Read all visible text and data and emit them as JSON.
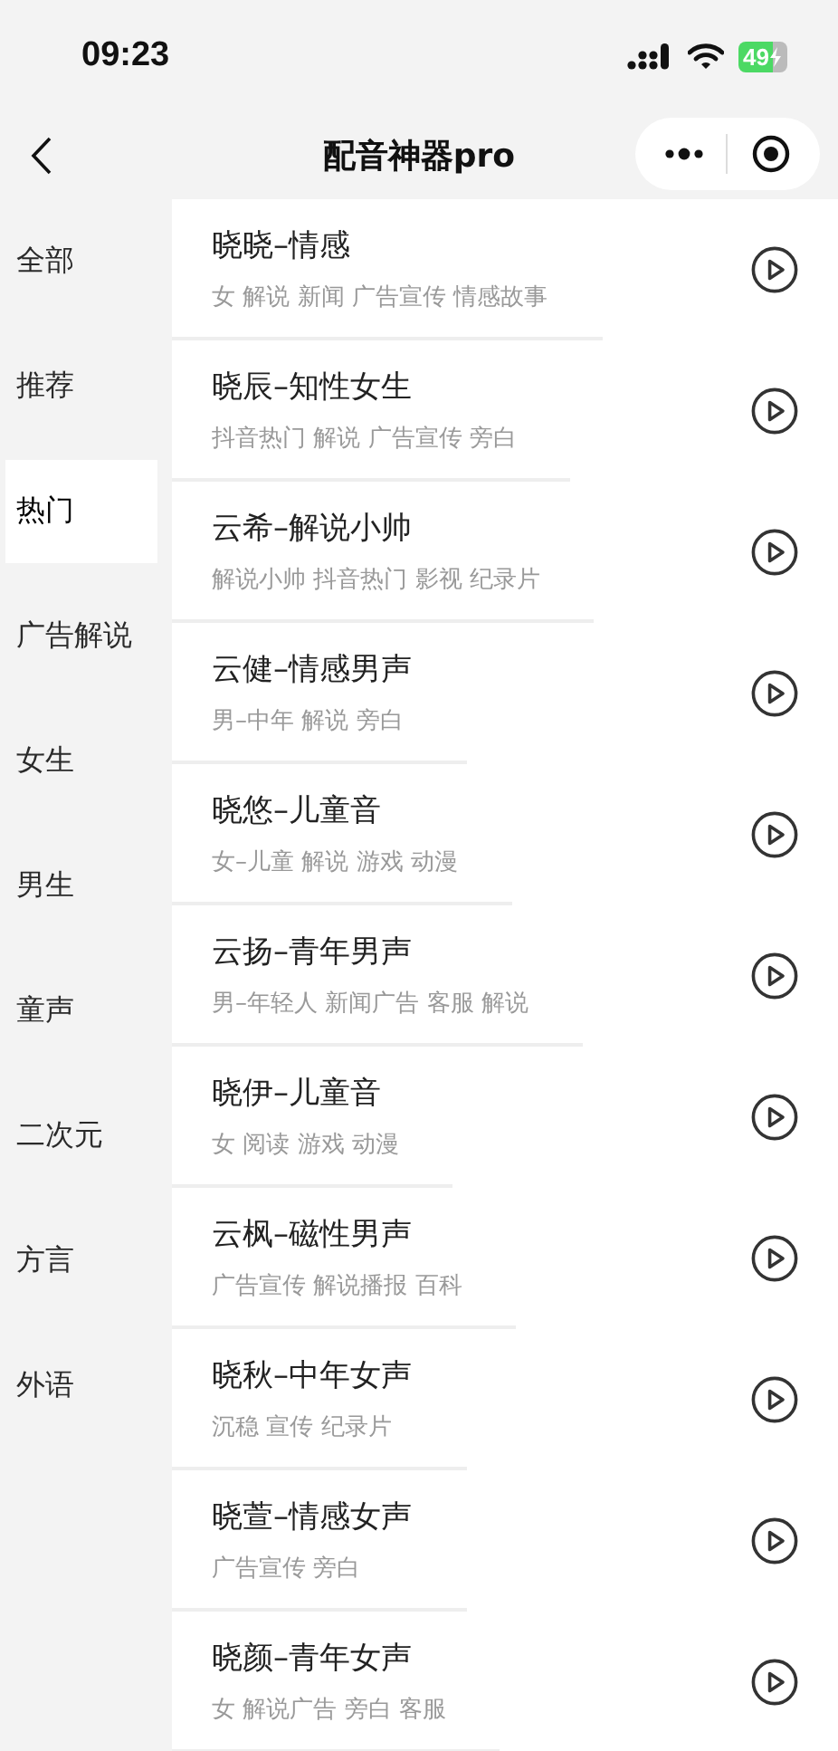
{
  "status_bar": {
    "time": "09:23",
    "battery": "49"
  },
  "nav": {
    "title": "配音神器pro"
  },
  "categories": [
    {
      "label": "全部",
      "selected": false
    },
    {
      "label": "推荐",
      "selected": false
    },
    {
      "label": "热门",
      "selected": true
    },
    {
      "label": "广告解说",
      "selected": false
    },
    {
      "label": "女生",
      "selected": false
    },
    {
      "label": "男生",
      "selected": false
    },
    {
      "label": "童声",
      "selected": false
    },
    {
      "label": "二次元",
      "selected": false
    },
    {
      "label": "方言",
      "selected": false
    },
    {
      "label": "外语",
      "selected": false
    }
  ],
  "voices": [
    {
      "name": "晓晓–情感",
      "tags": "女 解说 新闻 广告宣传 情感故事"
    },
    {
      "name": "晓辰–知性女生",
      "tags": "抖音热门 解说 广告宣传 旁白"
    },
    {
      "name": "云希–解说小帅",
      "tags": "解说小帅 抖音热门 影视 纪录片"
    },
    {
      "name": "云健–情感男声",
      "tags": "男–中年 解说 旁白"
    },
    {
      "name": "晓悠–儿童音",
      "tags": "女–儿童 解说 游戏 动漫"
    },
    {
      "name": "云扬–青年男声",
      "tags": "男–年轻人 新闻广告 客服 解说"
    },
    {
      "name": "晓伊–儿童音",
      "tags": "女 阅读 游戏 动漫"
    },
    {
      "name": "云枫–磁性男声",
      "tags": "广告宣传 解说播报 百科"
    },
    {
      "name": "晓秋–中年女声",
      "tags": "沉稳 宣传 纪录片"
    },
    {
      "name": "晓萱–情感女声",
      "tags": "广告宣传 旁白"
    },
    {
      "name": "晓颜–青年女声",
      "tags": "女 解说广告 旁白 客服"
    }
  ]
}
